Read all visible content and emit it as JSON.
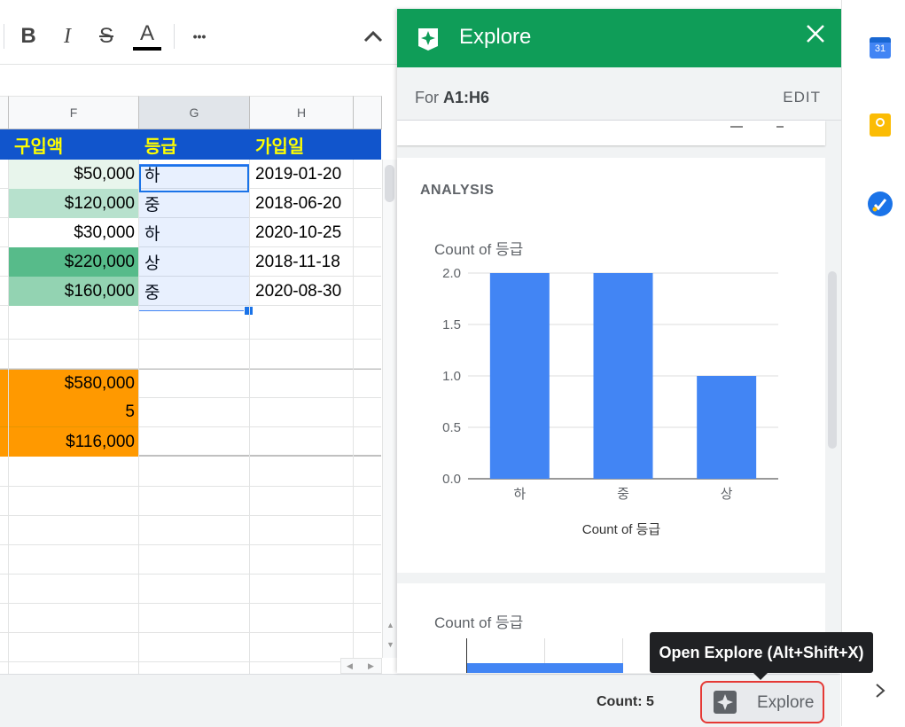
{
  "toolbar": {
    "bold": "B",
    "italic": "I",
    "strike": "S",
    "text_color": "A",
    "more": "•••"
  },
  "columns": [
    {
      "id": "F",
      "selected": false
    },
    {
      "id": "G",
      "selected": true
    },
    {
      "id": "H",
      "selected": false
    }
  ],
  "header_row": {
    "f": "구입액",
    "g": "등급",
    "h": "가입일"
  },
  "data_rows": [
    {
      "amount": "$50,000",
      "grade": "하",
      "date": "2019-01-20",
      "color": "#e8f5ec"
    },
    {
      "amount": "$120,000",
      "grade": "중",
      "date": "2018-06-20",
      "color": "#b7e1cd"
    },
    {
      "amount": "$30,000",
      "grade": "하",
      "date": "2020-10-25",
      "color": "#ffffff"
    },
    {
      "amount": "$220,000",
      "grade": "상",
      "date": "2018-11-18",
      "color": "#57bb8a"
    },
    {
      "amount": "$160,000",
      "grade": "중",
      "date": "2020-08-30",
      "color": "#93d3b2"
    }
  ],
  "summary_rows": [
    {
      "value": "$580,000"
    },
    {
      "value": "5"
    },
    {
      "value": "$116,000"
    }
  ],
  "colors": {
    "header_bg": "#1155cc",
    "header_text": "#ffff00",
    "summary_bg": "#ff9900",
    "explore_green": "#0f9d58",
    "bar": "#4285f4"
  },
  "explore": {
    "title": "Explore",
    "for_prefix": "For ",
    "range": "A1:H6",
    "edit": "EDIT",
    "analysis": "ANALYSIS",
    "chart2_title": "Count of 등급"
  },
  "chart_data": {
    "type": "bar",
    "title": "Count of 등급",
    "xlabel": "Count of 등급",
    "ylabel": "",
    "categories": [
      "하",
      "중",
      "상"
    ],
    "values": [
      2,
      2,
      1
    ],
    "ylim": [
      0,
      2
    ],
    "yticks": [
      "0.0",
      "0.5",
      "1.0",
      "1.5",
      "2.0"
    ],
    "grid": true
  },
  "status": {
    "count": "Count: 5",
    "explore_button": "Explore",
    "tooltip": "Open Explore (Alt+Shift+X)"
  },
  "side_apps": {
    "calendar_day": "31"
  }
}
